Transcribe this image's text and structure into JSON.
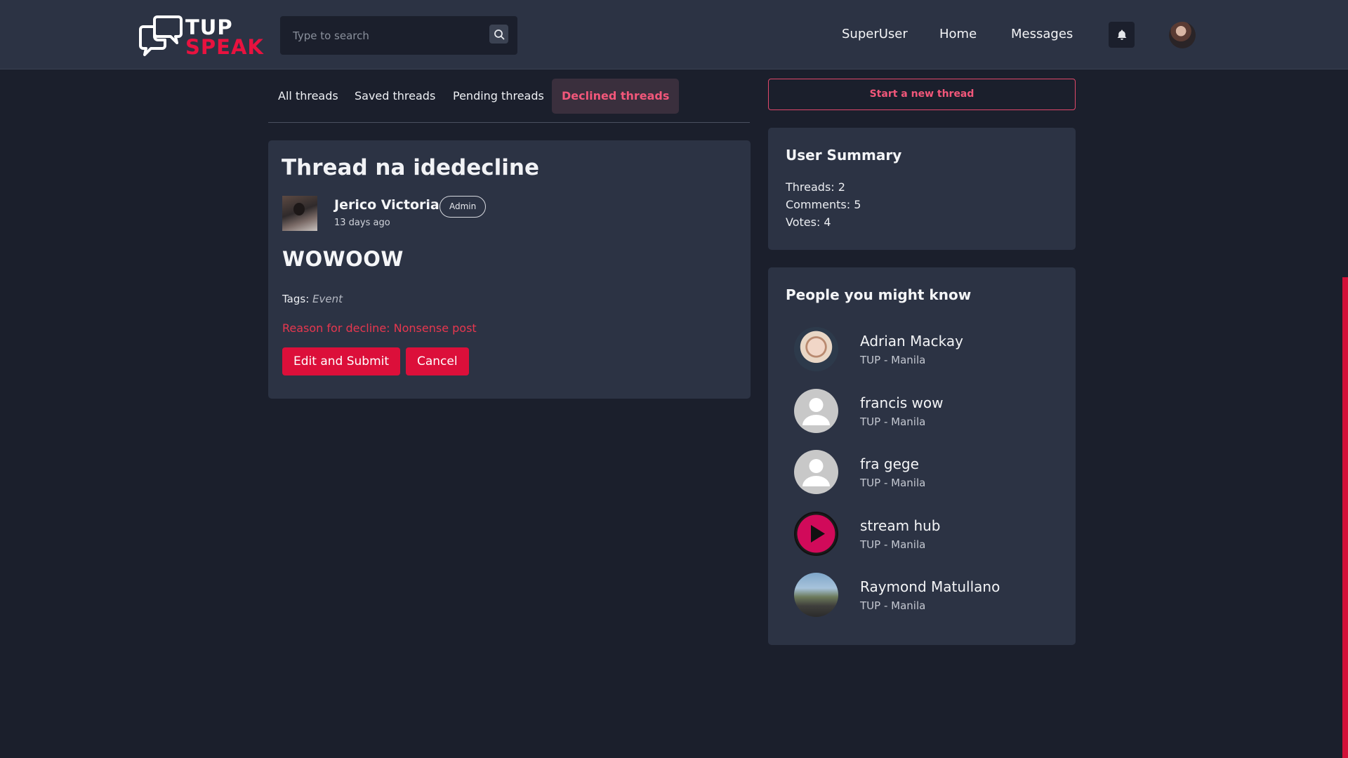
{
  "header": {
    "logo_top": "TUP",
    "logo_bottom": "SPEAK",
    "search_placeholder": "Type to search",
    "nav": [
      {
        "label": "SuperUser"
      },
      {
        "label": "Home"
      },
      {
        "label": "Messages"
      }
    ]
  },
  "tabs": [
    {
      "label": "All threads",
      "active": false
    },
    {
      "label": "Saved threads",
      "active": false
    },
    {
      "label": "Pending threads",
      "active": false
    },
    {
      "label": "Declined threads",
      "active": true
    }
  ],
  "thread": {
    "title": "Thread na idedecline",
    "author": "Jerico Victoria",
    "role": "Admin",
    "time": "13 days ago",
    "body": "WOWOOW",
    "tags_label": "Tags:",
    "tag": "Event",
    "decline_reason": "Reason for decline: Nonsense post",
    "edit_button": "Edit and Submit",
    "cancel_button": "Cancel"
  },
  "sidebar": {
    "new_thread_button": "Start a new thread",
    "summary": {
      "title": "User Summary",
      "threads": "Threads: 2",
      "comments": "Comments: 5",
      "votes": "Votes: 4"
    },
    "people": {
      "title": "People you might know",
      "items": [
        {
          "name": "Adrian Mackay",
          "location": "TUP - Manila",
          "avatar": "photo"
        },
        {
          "name": "francis wow",
          "location": "TUP - Manila",
          "avatar": "default-user-icon"
        },
        {
          "name": "fra gege",
          "location": "TUP - Manila",
          "avatar": "default-user-icon"
        },
        {
          "name": "stream hub",
          "location": "TUP - Manila",
          "avatar": "play-icon"
        },
        {
          "name": "Raymond Matullano",
          "location": "TUP - Manila",
          "avatar": "photo"
        }
      ]
    }
  },
  "colors": {
    "accent": "#dc0f3a",
    "header_bg": "#2c3344",
    "page_bg": "#1b1f2c",
    "card_bg": "#2c3344"
  }
}
